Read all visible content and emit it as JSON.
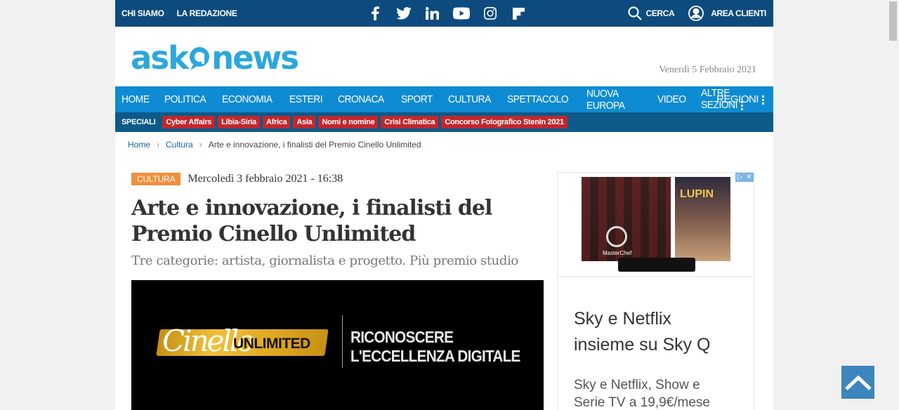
{
  "topbar": {
    "links": [
      "CHI SIAMO",
      "LA REDAZIONE"
    ],
    "social": [
      "facebook-icon",
      "twitter-icon",
      "linkedin-icon",
      "youtube-icon",
      "instagram-icon",
      "flipboard-icon"
    ],
    "search_label": "CERCA",
    "account_label": "AREA CLIENTI"
  },
  "brand": {
    "logo_text_left": "ask",
    "logo_text_right": "news",
    "color": "#2ba7dd",
    "date": "Venerdì 5 Febbraio 2021"
  },
  "mainnav": {
    "items": [
      "HOME",
      "POLITICA",
      "ECONOMIA",
      "ESTERI",
      "CRONACA",
      "SPORT",
      "CULTURA",
      "SPETTACOLO",
      "NUOVA EUROPA",
      "VIDEO",
      "ALTRE SEZIONI"
    ],
    "regioni": "REGIONI"
  },
  "speciali": {
    "label": "SPECIALI",
    "tags": [
      "Cyber Affairs",
      "Libia-Siria",
      "Africa",
      "Asia",
      "Nomi e nomine",
      "Crisi Climatica",
      "Concorso Fotografico Stenin 2021"
    ]
  },
  "breadcrumb": {
    "home": "Home",
    "section": "Cultura",
    "current": "Arte e innovazione, i finalisti del Premio Cinello Unlimited"
  },
  "article": {
    "category": "CULTURA",
    "published": "Mercoledì 3 febbraio 2021 - 16:38",
    "title": "Arte e innovazione, i finalisti del Premio Cinello Unlimited",
    "subtitle": "Tre categorie: artista, giornalista e progetto. Più premio studio",
    "hero": {
      "logo_script": "Cinello",
      "logo_word": "UNLIMITED",
      "tagline_1": "RICONOSCERE",
      "tagline_2": "L'ECCELLENZA DIGITALE"
    }
  },
  "ad": {
    "banner_word": "LUPIN",
    "banner_logo": "MasterChef",
    "title": "Sky e Netflix insieme su Sky Q",
    "subtitle": "Sky e Netflix, Show e Serie TV a 19,9€/mese"
  }
}
